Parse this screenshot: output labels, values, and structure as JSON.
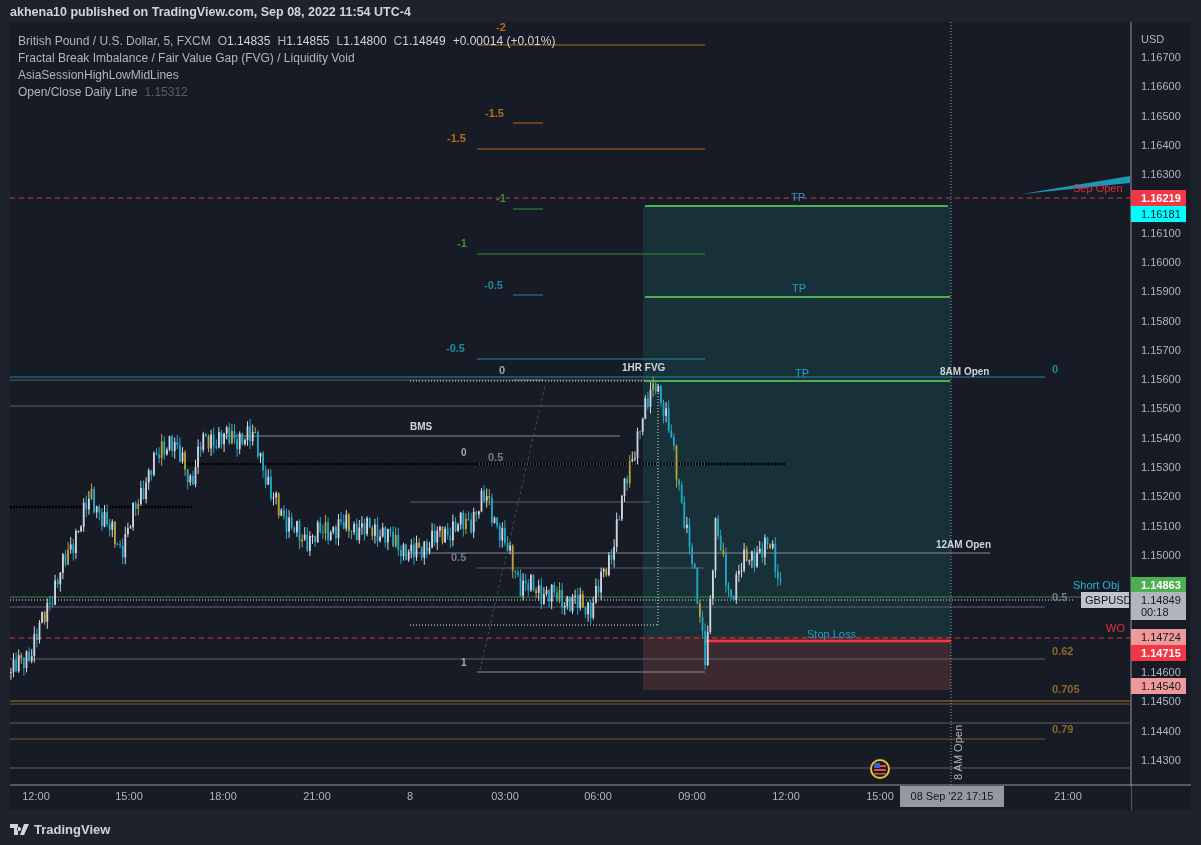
{
  "header": {
    "title": "akhena10 published on TradingView.com, Sep 08, 2022 11:54 UTC-4"
  },
  "legend": {
    "symbol": "British Pound / U.S. Dollar, 5, FXCM",
    "ohlc": [
      {
        "label": "O",
        "value": "1.14835"
      },
      {
        "label": "H",
        "value": "1.14855"
      },
      {
        "label": "L",
        "value": "1.14800"
      },
      {
        "label": "C",
        "value": "1.14849"
      }
    ],
    "change": "+0.00014 (+0.01%)",
    "indicators": [
      {
        "name": "Fractal Break Imbalance / Fair Value Gap (FVG) / Liquidity Void"
      },
      {
        "name": "AsiaSessionHighLowMidLines"
      },
      {
        "name": "Open/Close Daily Line",
        "value": "1.15312"
      }
    ]
  },
  "labels": [
    {
      "text": "-2",
      "kind": "level",
      "color": "#b06f12"
    },
    {
      "text": "-1.5",
      "kind": "level",
      "color": "#b06f12"
    },
    {
      "text": "-1.5",
      "kind": "level",
      "color": "#b06f12"
    },
    {
      "text": "-1",
      "kind": "level",
      "color": "#3f8a35"
    },
    {
      "text": "-1",
      "kind": "level",
      "color": "#3f8a35"
    },
    {
      "text": "-0.5",
      "kind": "level",
      "color": "#1b8ba0"
    },
    {
      "text": "-0.5",
      "kind": "level",
      "color": "#1b8ba0"
    },
    {
      "text": "0",
      "kind": "level",
      "color": "#a3a6af"
    },
    {
      "text": "1HR FVG",
      "kind": "note",
      "color": "#d1d4dc"
    },
    {
      "text": "TP",
      "kind": "target",
      "color": "#1fa3c0"
    },
    {
      "text": "TP",
      "kind": "target",
      "color": "#1fa3c0"
    },
    {
      "text": "TP",
      "kind": "target",
      "color": "#1fa3c0"
    },
    {
      "text": "8AM Open",
      "kind": "note",
      "color": "#d1d4dc"
    },
    {
      "text": "0",
      "kind": "level",
      "color": "#1b8ba0"
    },
    {
      "text": "BMS",
      "kind": "note",
      "color": "#d1d4dc"
    },
    {
      "text": "0",
      "kind": "note",
      "color": "#a3a6af"
    },
    {
      "text": "0.5",
      "kind": "level",
      "color": "#787b86"
    },
    {
      "text": "0.5",
      "kind": "level",
      "color": "#787b86"
    },
    {
      "text": "12AM Open",
      "kind": "note",
      "color": "#d1d4dc"
    },
    {
      "text": "Short Obj",
      "kind": "target",
      "color": "#22b5d0"
    },
    {
      "text": "0.5",
      "kind": "level",
      "color": "#787b86"
    },
    {
      "text": "WO",
      "kind": "target",
      "color": "#e0303f"
    },
    {
      "text": "Stop Loss",
      "kind": "target",
      "color": "#1fa3c0"
    },
    {
      "text": "0.62",
      "kind": "level",
      "color": "#8a6a2a"
    },
    {
      "text": "1",
      "kind": "note",
      "color": "#a3a6af"
    },
    {
      "text": "0.705",
      "kind": "level",
      "color": "#8a6a2a"
    },
    {
      "text": "0.79",
      "kind": "level",
      "color": "#8a6a2a"
    },
    {
      "text": "Sep Open",
      "kind": "target",
      "color": "#e0303f"
    },
    {
      "text": "8 AM Open",
      "kind": "vertical",
      "color": "#b2b5be"
    }
  ],
  "symbol_tag": "GBPUSD",
  "price_axis": {
    "currency": "USD",
    "ticks": [
      "1.16700",
      "1.16600",
      "1.16500",
      "1.16400",
      "1.16300",
      "1.16100",
      "1.16000",
      "1.15900",
      "1.15800",
      "1.15700",
      "1.15600",
      "1.15500",
      "1.15400",
      "1.15300",
      "1.15200",
      "1.15100",
      "1.15000",
      "1.14600",
      "1.14500",
      "1.14400",
      "1.14300"
    ]
  },
  "price_tags": [
    {
      "value": "1.16219",
      "color": "#f23645",
      "kind": "solid"
    },
    {
      "value": "1.16181",
      "color": "#00ffff",
      "kind": "pale"
    },
    {
      "value": "1.14863",
      "color": "#4caf50",
      "kind": "solid"
    },
    {
      "value": "1.14849",
      "countdown": "00:18",
      "color": "#b2b5be",
      "kind": "pale"
    },
    {
      "value": "1.14724",
      "color": "#ef9a9a",
      "kind": "pale"
    },
    {
      "value": "1.14715",
      "color": "#f23645",
      "kind": "solid"
    },
    {
      "value": "1.14540",
      "color": "#ef9a9a",
      "kind": "pale"
    }
  ],
  "time_axis": {
    "labels": [
      "12:00",
      "15:00",
      "18:00",
      "21:00",
      "8",
      "03:00",
      "06:00",
      "09:00",
      "12:00",
      "15:00",
      "21:00"
    ],
    "crosshair": "08 Sep '22  17:15"
  },
  "footer": {
    "brand": "TradingView"
  }
}
